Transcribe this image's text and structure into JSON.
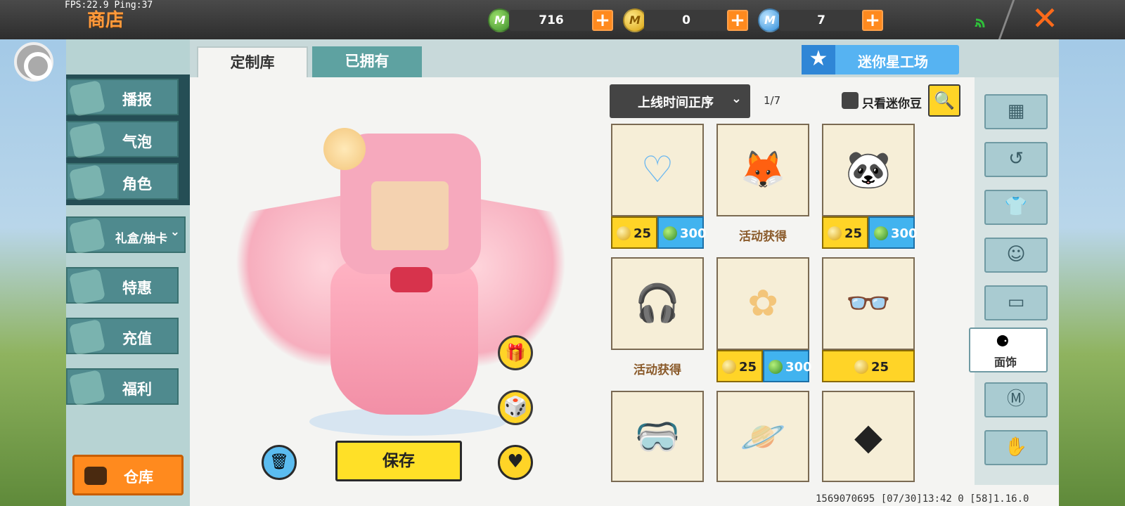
{
  "debug": {
    "fps_ping": "FPS:22.9  Ping:37"
  },
  "header": {
    "title": "商店",
    "currencies": [
      {
        "name": "mini-bean",
        "icon": "green-coin-icon",
        "value": "716"
      },
      {
        "name": "mini-coin",
        "icon": "gold-coin-icon",
        "value": "0"
      },
      {
        "name": "mini-point",
        "icon": "blue-coin-icon",
        "value": "7"
      }
    ],
    "coin_letter": "M",
    "plus_label": "+",
    "close_label": "✕"
  },
  "sidebar": {
    "items": [
      {
        "label": "播报",
        "icon": "broadcast-icon"
      },
      {
        "label": "气泡",
        "icon": "bubble-icon"
      },
      {
        "label": "角色",
        "icon": "character-icon"
      },
      {
        "label": "礼盒/抽卡",
        "icon": "giftbox-icon",
        "chevron": "⌄"
      },
      {
        "label": "特惠",
        "icon": "sale-icon"
      },
      {
        "label": "充值",
        "icon": "coins-icon"
      },
      {
        "label": "福利",
        "icon": "gift-icon"
      }
    ],
    "warehouse_label": "仓库"
  },
  "tabs": [
    {
      "label": "定制库",
      "active": true
    },
    {
      "label": "已拥有",
      "active": false
    }
  ],
  "workshop": {
    "label": "迷你星工场",
    "star": "★"
  },
  "preview": {
    "gift_icon": "🎁",
    "dice_icon": "🎲",
    "trash_icon": "🗑",
    "save_label": "保存",
    "heart_icon": "♥"
  },
  "filter": {
    "sort_label": "上线时间正序",
    "chevron": "⌄",
    "page": "1/7",
    "only_label": "只看迷你豆",
    "search_icon": "🔍"
  },
  "items": [
    {
      "name": "heart-eye-mask",
      "glyph": "♡",
      "gold": "25",
      "blue": "300"
    },
    {
      "name": "fox-mask",
      "glyph": "🦊",
      "event": "活动获得"
    },
    {
      "name": "red-panda-mask",
      "glyph": "🐼",
      "gold": "25",
      "blue": "300"
    },
    {
      "name": "headset",
      "glyph": "🎧",
      "event": "活动获得"
    },
    {
      "name": "flower-ornament",
      "glyph": "✿",
      "gold": "25",
      "blue": "300"
    },
    {
      "name": "round-glasses",
      "glyph": "👓",
      "gold": "25"
    },
    {
      "name": "green-goggles",
      "glyph": "🥽"
    },
    {
      "name": "planet-hat",
      "glyph": "🪐"
    },
    {
      "name": "black-eye-mask",
      "glyph": "◆"
    }
  ],
  "categories": [
    {
      "name": "all",
      "glyph": "▦"
    },
    {
      "name": "recent",
      "glyph": "↺"
    },
    {
      "name": "outfit",
      "glyph": "👕"
    },
    {
      "name": "face",
      "glyph": "☺"
    },
    {
      "name": "expression",
      "glyph": "▭"
    },
    {
      "name": "face-ornament",
      "glyph": "⚈",
      "label": "面饰",
      "selected": true
    },
    {
      "name": "m-shirt",
      "glyph": "Ⓜ"
    },
    {
      "name": "hand",
      "glyph": "✋"
    }
  ],
  "footer": {
    "info": "1569070695  [07/30]13:42 0  [58]1.16.0"
  }
}
